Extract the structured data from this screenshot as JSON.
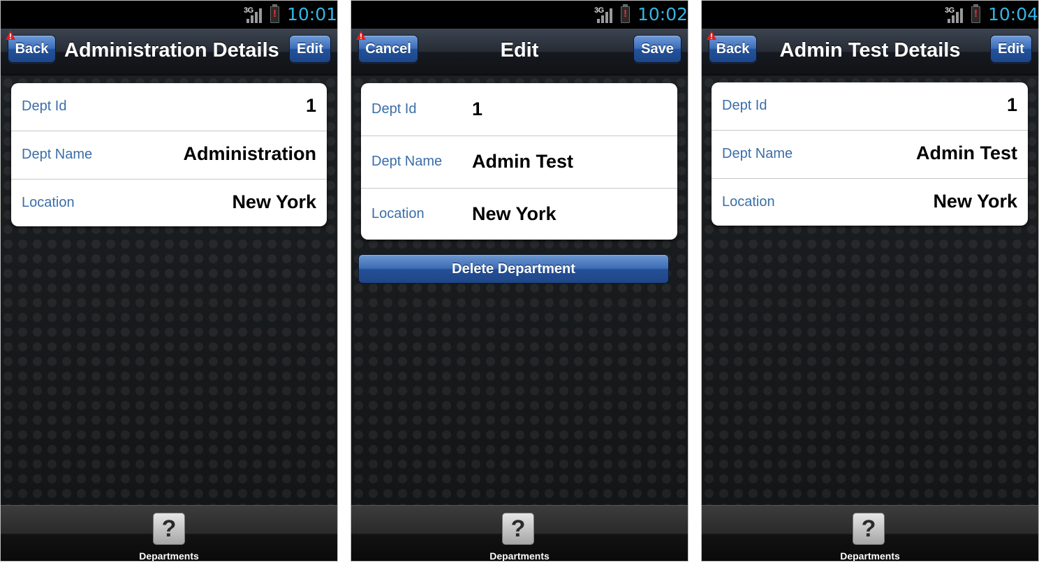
{
  "screens": [
    {
      "status": {
        "network": "3G",
        "time": "10:01"
      },
      "header": {
        "left_button": "Back",
        "title": "Administration Details",
        "right_button": "Edit"
      },
      "fields": [
        {
          "label": "Dept Id",
          "value": "1"
        },
        {
          "label": "Dept Name",
          "value": "Administration"
        },
        {
          "label": "Location",
          "value": "New York"
        }
      ],
      "tab": {
        "icon": "?",
        "label": "Departments"
      }
    },
    {
      "status": {
        "network": "3G",
        "time": "10:02"
      },
      "header": {
        "left_button": "Cancel",
        "title": "Edit",
        "right_button": "Save"
      },
      "fields": [
        {
          "label": "Dept Id",
          "value": "1"
        },
        {
          "label": "Dept Name",
          "value": "Admin Test"
        },
        {
          "label": "Location",
          "value": "New York"
        }
      ],
      "delete_button": "Delete Department",
      "tab": {
        "icon": "?",
        "label": "Departments"
      }
    },
    {
      "status": {
        "network": "3G",
        "time": "10:04"
      },
      "header": {
        "left_button": "Back",
        "title": "Admin Test Details",
        "right_button": "Edit"
      },
      "fields": [
        {
          "label": "Dept Id",
          "value": "1"
        },
        {
          "label": "Dept Name",
          "value": "Admin Test"
        },
        {
          "label": "Location",
          "value": "New York"
        }
      ],
      "tab": {
        "icon": "?",
        "label": "Departments"
      }
    }
  ],
  "colors": {
    "label_text": "#3a6ea8",
    "clock_text": "#33b5e5",
    "button_blue": "#3b6db8"
  }
}
